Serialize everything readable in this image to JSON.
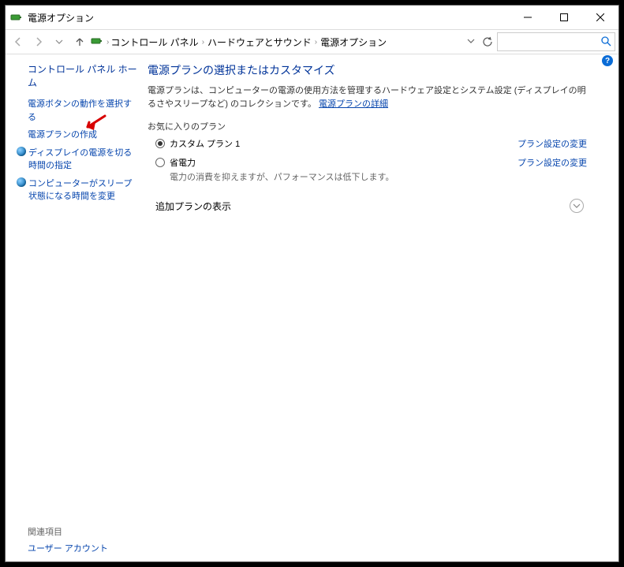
{
  "window": {
    "title": "電源オプション"
  },
  "breadcrumb": {
    "items": [
      "コントロール パネル",
      "ハードウェアとサウンド",
      "電源オプション"
    ]
  },
  "search": {
    "placeholder": ""
  },
  "sidebar": {
    "home": "コントロール パネル ホーム",
    "links": {
      "power_button": "電源ボタンの動作を選択する",
      "create_plan": "電源プランの作成",
      "display_off": "ディスプレイの電源を切る時間の指定",
      "sleep": "コンピューターがスリープ状態になる時間を変更"
    },
    "related": {
      "title": "関連項目",
      "user_accounts": "ユーザー アカウント"
    }
  },
  "main": {
    "heading": "電源プランの選択またはカスタマイズ",
    "description_1": "電源プランは、コンピューターの電源の使用方法を管理するハードウェア設定とシステム設定 (ディスプレイの明るさやスリープなど) のコレクションです。",
    "plan_details_link": "電源プランの詳細",
    "favorite_label": "お気に入りのプラン",
    "plans": [
      {
        "name": "カスタム プラン 1",
        "desc": "",
        "change": "プラン設定の変更",
        "selected": true
      },
      {
        "name": "省電力",
        "desc": "電力の消費を抑えますが、パフォーマンスは低下します。",
        "change": "プラン設定の変更",
        "selected": false
      }
    ],
    "additional": "追加プランの表示"
  }
}
